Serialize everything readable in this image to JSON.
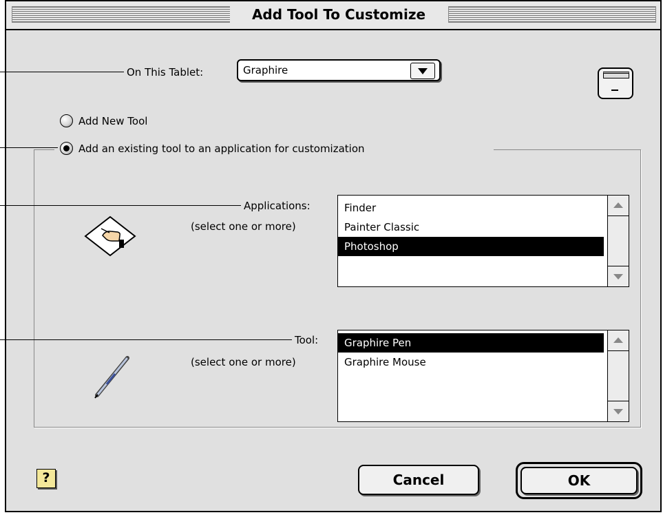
{
  "window": {
    "title": "Add Tool To Customize"
  },
  "tablet": {
    "label": "On This Tablet:",
    "selected": "Graphire"
  },
  "mode": {
    "options": [
      {
        "label": "Add New Tool",
        "selected": false
      },
      {
        "label": "Add an existing tool to an application for customization",
        "selected": true
      }
    ]
  },
  "applications": {
    "label": "Applications:",
    "hint": "(select one or more)",
    "items": [
      {
        "label": "Finder",
        "selected": false
      },
      {
        "label": "Painter Classic",
        "selected": false
      },
      {
        "label": "Photoshop",
        "selected": true
      }
    ]
  },
  "tool": {
    "label": "Tool:",
    "hint": "(select one or more)",
    "items": [
      {
        "label": "Graphire Pen",
        "selected": true
      },
      {
        "label": "Graphire Mouse",
        "selected": false
      }
    ]
  },
  "buttons": {
    "cancel": "Cancel",
    "ok": "OK",
    "help": "?"
  },
  "icons": {
    "tablet": "tablet-icon",
    "application": "hand-document-icon",
    "tool": "pen-icon",
    "help": "help-icon",
    "popup_arrow": "triangle-down-icon",
    "scroll_up": "scroll-up-arrow-icon",
    "scroll_down": "scroll-down-arrow-icon"
  }
}
